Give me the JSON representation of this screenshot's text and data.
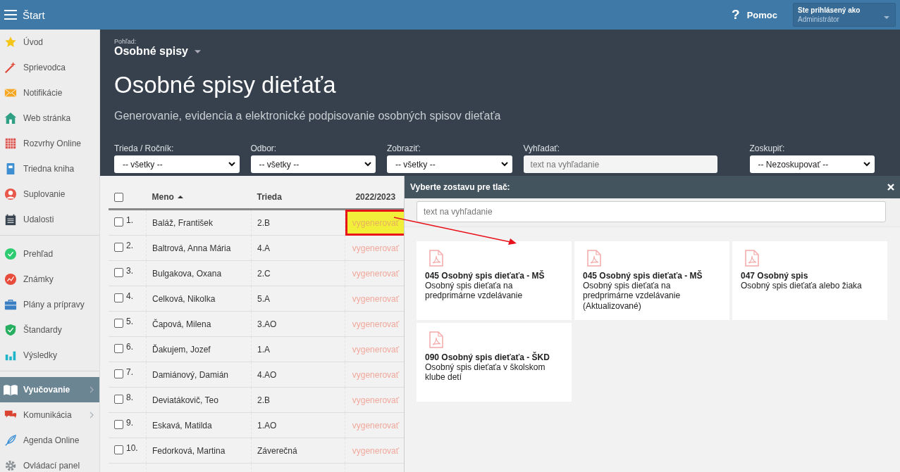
{
  "topbar": {
    "title": "Štart",
    "help_glyph": "?",
    "help_label": "Pomoc",
    "user_caption": "Ste prihlásený ako",
    "user_name": "Administrátor"
  },
  "sidebar": {
    "sections": [
      {
        "items": [
          {
            "label": "Úvod",
            "active": false,
            "submenu": false
          },
          {
            "label": "Sprievodca",
            "active": false,
            "submenu": false
          },
          {
            "label": "Notifikácie",
            "active": false,
            "submenu": false
          },
          {
            "label": "Web stránka",
            "active": false,
            "submenu": false
          },
          {
            "label": "Rozvrhy Online",
            "active": false,
            "submenu": false
          },
          {
            "label": "Triedna kniha",
            "active": false,
            "submenu": false
          },
          {
            "label": "Suplovanie",
            "active": false,
            "submenu": false
          },
          {
            "label": "Udalosti",
            "active": false,
            "submenu": false
          }
        ]
      },
      {
        "items": [
          {
            "label": "Prehľad",
            "active": false,
            "submenu": false
          },
          {
            "label": "Známky",
            "active": false,
            "submenu": false
          },
          {
            "label": "Plány a prípravy",
            "active": false,
            "submenu": false
          },
          {
            "label": "Štandardy",
            "active": false,
            "submenu": false
          },
          {
            "label": "Výsledky",
            "active": false,
            "submenu": false
          }
        ]
      },
      {
        "items": [
          {
            "label": "Vyučovanie",
            "active": true,
            "submenu": true
          },
          {
            "label": "Komunikácia",
            "active": false,
            "submenu": true
          },
          {
            "label": "Agenda Online",
            "active": false,
            "submenu": false
          },
          {
            "label": "Ovládací panel",
            "active": false,
            "submenu": false
          }
        ]
      }
    ]
  },
  "header": {
    "view_caption": "Pohľad:",
    "view_value": "Osobné spisy",
    "title": "Osobné spisy dieťaťa",
    "subtitle": "Generovanie, evidencia a elektronické podpisovanie osobných spisov dieťaťa"
  },
  "filters": [
    {
      "kind": "select",
      "label": "Trieda / Ročník:",
      "value": "-- všetky --"
    },
    {
      "kind": "select",
      "label": "Odbor:",
      "value": "-- všetky --"
    },
    {
      "kind": "select",
      "label": "Zobraziť:",
      "value": "-- všetky --"
    },
    {
      "kind": "search",
      "label": "Vyhľadať:",
      "placeholder": "text na vyhľadanie"
    },
    {
      "kind": "select",
      "label": "Zoskupiť:",
      "value": "-- Nezoskupovať --"
    }
  ],
  "table": {
    "header_checked": false,
    "columns": [
      "Meno",
      "Trieda",
      "2022/2023"
    ],
    "sort_ascending": true,
    "rows": [
      {
        "checked": false,
        "number": "1.",
        "name": "Baláž, František",
        "class": "2.B",
        "action": "vygenerovať",
        "highlighted": true
      },
      {
        "checked": false,
        "number": "2.",
        "name": "Baltrová, Anna Mária",
        "class": "4.A",
        "action": "vygenerovať",
        "highlighted": false
      },
      {
        "checked": false,
        "number": "3.",
        "name": "Bulgakova, Oxana",
        "class": "2.C",
        "action": "vygenerovať",
        "highlighted": false
      },
      {
        "checked": false,
        "number": "4.",
        "name": "Celková, Nikolka",
        "class": "5.A",
        "action": "vygenerovať",
        "highlighted": false
      },
      {
        "checked": false,
        "number": "5.",
        "name": "Čapová, Milena",
        "class": "3.AO",
        "action": "vygenerovať",
        "highlighted": false
      },
      {
        "checked": false,
        "number": "6.",
        "name": "Ďakujem, Jozef",
        "class": "1.A",
        "action": "vygenerovať",
        "highlighted": false
      },
      {
        "checked": false,
        "number": "7.",
        "name": "Damiánový, Damián",
        "class": "4.AO",
        "action": "vygenerovať",
        "highlighted": false
      },
      {
        "checked": false,
        "number": "8.",
        "name": "Deviatákovič, Teo",
        "class": "2.B",
        "action": "vygenerovať",
        "highlighted": false
      },
      {
        "checked": false,
        "number": "9.",
        "name": "Eskavá, Matilda",
        "class": "1.AO",
        "action": "vygenerovať",
        "highlighted": false
      },
      {
        "checked": false,
        "number": "10.",
        "name": "Fedorková, Martina",
        "class": "Záverečná",
        "action": "vygenerovať",
        "highlighted": false
      }
    ]
  },
  "print_dialog": {
    "title": "Vyberte zostavu pre tlač:",
    "search_placeholder": "text na vyhľadanie",
    "reports": [
      {
        "title": "045 Osobný spis dieťaťa - MŠ",
        "description": "Osobný spis dieťaťa na predprimárne vzdelávanie"
      },
      {
        "title": "045 Osobný spis dieťaťa - MŠ",
        "description": "Osobný spis dieťaťa na predprimárne vzdelávanie (Aktualizované)"
      },
      {
        "title": "047 Osobný spis",
        "description": "Osobný spis dieťaťa alebo žiaka"
      },
      {
        "title": "090 Osobný spis dieťaťa - ŠKD",
        "description": "Osobný spis dieťaťa v školskom klube detí"
      }
    ]
  }
}
